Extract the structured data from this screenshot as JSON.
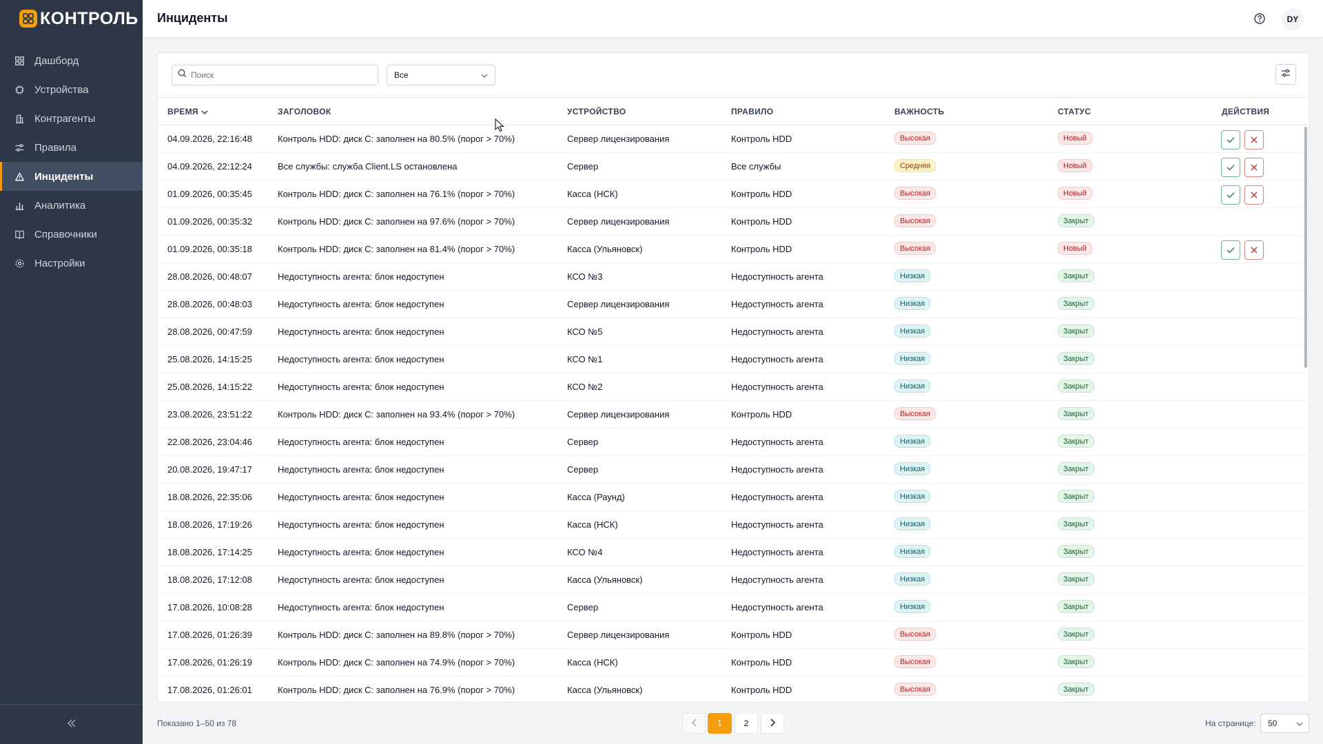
{
  "app": {
    "name": "КОНТРОЛЬ"
  },
  "sidebar": {
    "items": [
      {
        "label": "Дашборд",
        "icon": "grid-icon"
      },
      {
        "label": "Устройства",
        "icon": "chip-icon"
      },
      {
        "label": "Контрагенты",
        "icon": "building-icon"
      },
      {
        "label": "Правила",
        "icon": "sliders-icon"
      },
      {
        "label": "Инциденты",
        "icon": "alert-triangle-icon",
        "active": true
      },
      {
        "label": "Аналитика",
        "icon": "bar-chart-icon"
      },
      {
        "label": "Справочники",
        "icon": "book-icon"
      },
      {
        "label": "Настройки",
        "icon": "gear-icon"
      }
    ],
    "collapse_icon": "double-chevron-left-icon"
  },
  "header": {
    "title": "Инциденты",
    "avatar_initials": "DY",
    "help_icon": "help-circle-icon"
  },
  "filters": {
    "search_placeholder": "Поиск",
    "search_value": "",
    "status_filter": "Все"
  },
  "table": {
    "columns": {
      "time": "ВРЕМЯ",
      "title": "ЗАГОЛОВОК",
      "device": "УСТРОЙСТВО",
      "rule": "ПРАВИЛО",
      "severity": "ВАЖНОСТЬ",
      "status": "СТАТУС",
      "actions": "ДЕЙСТВИЯ"
    },
    "rows": [
      {
        "time": "04.09.2026, 22:16:48",
        "title": "Контроль HDD: диск C: заполнен на 80.5% (порог > 70%)",
        "device": "Сервер лицензирования",
        "rule": "Контроль HDD",
        "severity": "Высокая",
        "status": "Новый",
        "actions": true
      },
      {
        "time": "04.09.2026, 22:12:24",
        "title": "Все службы: служба Client.LS остановлена",
        "device": "Сервер",
        "rule": "Все службы",
        "severity": "Средняя",
        "status": "Новый",
        "actions": true
      },
      {
        "time": "01.09.2026, 00:35:45",
        "title": "Контроль HDD: диск C: заполнен на 76.1% (порог > 70%)",
        "device": "Касса (НСК)",
        "rule": "Контроль HDD",
        "severity": "Высокая",
        "status": "Новый",
        "actions": true
      },
      {
        "time": "01.09.2026, 00:35:32",
        "title": "Контроль HDD: диск C: заполнен на 97.6% (порог > 70%)",
        "device": "Сервер лицензирования",
        "rule": "Контроль HDD",
        "severity": "Высокая",
        "status": "Закрыт",
        "actions": false
      },
      {
        "time": "01.09.2026, 00:35:18",
        "title": "Контроль HDD: диск C: заполнен на 81.4% (порог > 70%)",
        "device": "Касса (Ульяновск)",
        "rule": "Контроль HDD",
        "severity": "Высокая",
        "status": "Новый",
        "actions": true
      },
      {
        "time": "28.08.2026, 00:48:07",
        "title": "Недоступность агента: блок недоступен",
        "device": "КСО №3",
        "rule": "Недоступность агента",
        "severity": "Низкая",
        "status": "Закрыт",
        "actions": false
      },
      {
        "time": "28.08.2026, 00:48:03",
        "title": "Недоступность агента: блок недоступен",
        "device": "Сервер лицензирования",
        "rule": "Недоступность агента",
        "severity": "Низкая",
        "status": "Закрыт",
        "actions": false
      },
      {
        "time": "28.08.2026, 00:47:59",
        "title": "Недоступность агента: блок недоступен",
        "device": "КСО №5",
        "rule": "Недоступность агента",
        "severity": "Низкая",
        "status": "Закрыт",
        "actions": false
      },
      {
        "time": "25.08.2026, 14:15:25",
        "title": "Недоступность агента: блок недоступен",
        "device": "КСО №1",
        "rule": "Недоступность агента",
        "severity": "Низкая",
        "status": "Закрыт",
        "actions": false
      },
      {
        "time": "25.08.2026, 14:15:22",
        "title": "Недоступность агента: блок недоступен",
        "device": "КСО №2",
        "rule": "Недоступность агента",
        "severity": "Низкая",
        "status": "Закрыт",
        "actions": false
      },
      {
        "time": "23.08.2026, 23:51:22",
        "title": "Контроль HDD: диск C: заполнен на 93.4% (порог > 70%)",
        "device": "Сервер лицензирования",
        "rule": "Контроль HDD",
        "severity": "Высокая",
        "status": "Закрыт",
        "actions": false
      },
      {
        "time": "22.08.2026, 23:04:46",
        "title": "Недоступность агента: блок недоступен",
        "device": "Сервер",
        "rule": "Недоступность агента",
        "severity": "Низкая",
        "status": "Закрыт",
        "actions": false
      },
      {
        "time": "20.08.2026, 19:47:17",
        "title": "Недоступность агента: блок недоступен",
        "device": "Сервер",
        "rule": "Недоступность агента",
        "severity": "Низкая",
        "status": "Закрыт",
        "actions": false
      },
      {
        "time": "18.08.2026, 22:35:06",
        "title": "Недоступность агента: блок недоступен",
        "device": "Касса (Раунд)",
        "rule": "Недоступность агента",
        "severity": "Низкая",
        "status": "Закрыт",
        "actions": false
      },
      {
        "time": "18.08.2026, 17:19:26",
        "title": "Недоступность агента: блок недоступен",
        "device": "Касса (НСК)",
        "rule": "Недоступность агента",
        "severity": "Низкая",
        "status": "Закрыт",
        "actions": false
      },
      {
        "time": "18.08.2026, 17:14:25",
        "title": "Недоступность агента: блок недоступен",
        "device": "КСО №4",
        "rule": "Недоступность агента",
        "severity": "Низкая",
        "status": "Закрыт",
        "actions": false
      },
      {
        "time": "18.08.2026, 17:12:08",
        "title": "Недоступность агента: блок недоступен",
        "device": "Касса (Ульяновск)",
        "rule": "Недоступность агента",
        "severity": "Низкая",
        "status": "Закрыт",
        "actions": false
      },
      {
        "time": "17.08.2026, 10:08:28",
        "title": "Недоступность агента: блок недоступен",
        "device": "Сервер",
        "rule": "Недоступность агента",
        "severity": "Низкая",
        "status": "Закрыт",
        "actions": false
      },
      {
        "time": "17.08.2026, 01:26:39",
        "title": "Контроль HDD: диск C: заполнен на 89.8% (порог > 70%)",
        "device": "Сервер лицензирования",
        "rule": "Контроль HDD",
        "severity": "Высокая",
        "status": "Закрыт",
        "actions": false
      },
      {
        "time": "17.08.2026, 01:26:19",
        "title": "Контроль HDD: диск C: заполнен на 74.9% (порог > 70%)",
        "device": "Касса (НСК)",
        "rule": "Контроль HDD",
        "severity": "Высокая",
        "status": "Закрыт",
        "actions": false
      },
      {
        "time": "17.08.2026, 01:26:01",
        "title": "Контроль HDD: диск C: заполнен на 76.9% (порог > 70%)",
        "device": "Касса (Ульяновск)",
        "rule": "Контроль HDD",
        "severity": "Высокая",
        "status": "Закрыт",
        "actions": false
      }
    ]
  },
  "footer": {
    "summary": "Показано 1–50 из 78",
    "pages": [
      "1",
      "2"
    ],
    "current_page": "1",
    "per_page_label": "На странице:",
    "per_page_value": "50"
  },
  "colors": {
    "accent": "#f59e0b",
    "sidebar_bg": "#2d3748",
    "severity_high": "#b91c1c",
    "severity_medium": "#92400e",
    "severity_low": "#0f5c63",
    "status_new": "#b91c1c",
    "status_closed": "#166534"
  }
}
